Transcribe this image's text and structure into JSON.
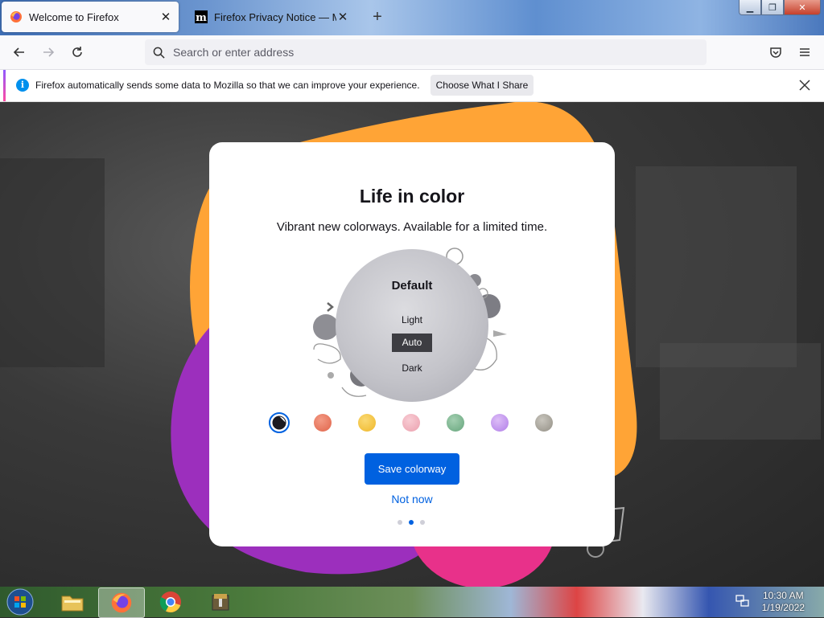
{
  "tabs": [
    {
      "title": "Welcome to Firefox",
      "active": true,
      "icon": "firefox-icon"
    },
    {
      "title": "Firefox Privacy Notice — Mozilla",
      "active": false,
      "icon": "mozilla-m-icon"
    }
  ],
  "navbar": {
    "search_placeholder": "Search or enter address"
  },
  "notification": {
    "text": "Firefox automatically sends some data to Mozilla so that we can improve your experience.",
    "button_label": "Choose What I Share"
  },
  "card": {
    "title": "Life in color",
    "subtitle": "Vibrant new colorways. Available for a limited time.",
    "theme_name": "Default",
    "options": [
      "Light",
      "Auto",
      "Dark"
    ],
    "selected_option": "Auto",
    "save_label": "Save colorway",
    "not_now_label": "Not now",
    "swatches": [
      {
        "name": "default",
        "color": "#1c1b22",
        "selected": true
      },
      {
        "name": "red",
        "color": "#e8745a"
      },
      {
        "name": "yellow",
        "color": "#f5c542"
      },
      {
        "name": "pink",
        "color": "#f2b0bd"
      },
      {
        "name": "green",
        "color": "#7cb591"
      },
      {
        "name": "purple",
        "color": "#c79af0"
      },
      {
        "name": "grey",
        "color": "#a7a49b"
      }
    ],
    "page_dots": 3,
    "active_dot": 1
  },
  "colors": {
    "accent_blue": "#0061e0",
    "blob_orange": "#ffa436",
    "blob_purple": "#9c2fbd",
    "blob_pink": "#e8318a"
  },
  "taskbar": {
    "items": [
      "windows-explorer-icon",
      "firefox-icon",
      "chrome-icon",
      "archive-icon"
    ],
    "time": "10:30 AM",
    "date": "1/19/2022"
  }
}
